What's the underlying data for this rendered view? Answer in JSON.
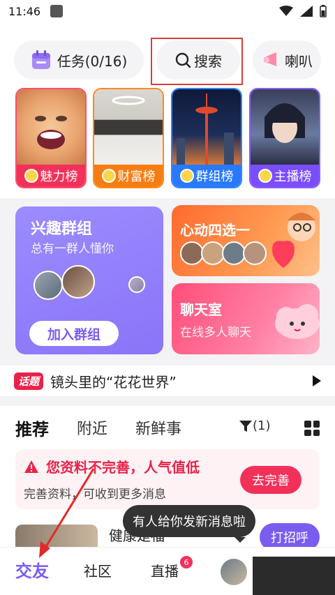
{
  "status_bar": {
    "time": "11:46"
  },
  "top_row": {
    "task_label": "任务(0/16)",
    "search_label": "搜索",
    "horn_label": "喇叭"
  },
  "rank_tiles": [
    {
      "label": "魅力榜"
    },
    {
      "label": "财富榜"
    },
    {
      "label": "群组榜"
    },
    {
      "label": "主播榜"
    }
  ],
  "features": {
    "group": {
      "title": "兴趣群组",
      "subtitle": "总有一群人懂你",
      "join_label": "加入群组"
    },
    "match": {
      "title": "心动四选一"
    },
    "chat": {
      "title": "聊天室",
      "subtitle": "在线多人聊天"
    }
  },
  "topic": {
    "badge": "话题",
    "text": "镜头里的“花花世界”"
  },
  "tabs": {
    "items": [
      "推荐",
      "附近",
      "新鲜事"
    ],
    "filter_count": "(1)"
  },
  "warning": {
    "title": "您资料不完善，人气值低",
    "subtitle": "完善资料，可收到更多消息",
    "button": "去完善"
  },
  "user_row": {
    "name": "健康是福",
    "greet": "打招呼"
  },
  "tooltip": {
    "text": "有人给你发新消息啦"
  },
  "bottom_nav": {
    "items": [
      "交友",
      "社区",
      "直播"
    ],
    "live_badge": "6"
  }
}
